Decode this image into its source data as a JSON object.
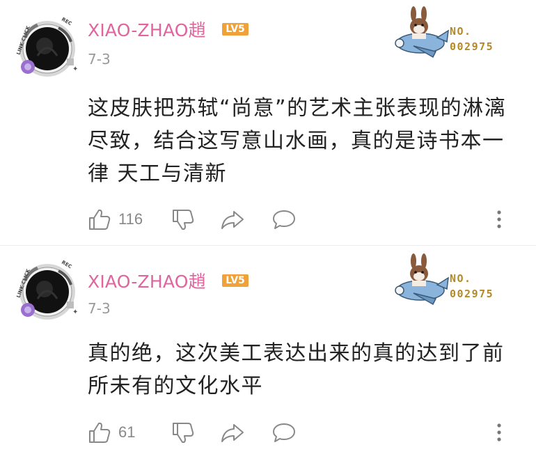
{
  "comments": [
    {
      "username": "XIAO-ZHAO趙",
      "level": "LV5",
      "date": "7-3",
      "badge": {
        "line1": "NO.",
        "line2": "002975"
      },
      "avatar": {
        "ring_text_left": "LINK-CLICK",
        "ring_text_top": "REC"
      },
      "text": "这皮肤把苏轼“尚意”的艺术主张表现的淋漓尽致，结合这写意山水画，真的是诗书本一律 天工与清新",
      "like_count": "116",
      "icons": [
        "thumbs-up-icon",
        "thumbs-down-icon",
        "share-icon",
        "comment-bubble-icon",
        "more-vertical-icon"
      ]
    },
    {
      "username": "XIAO-ZHAO趙",
      "level": "LV5",
      "date": "7-3",
      "badge": {
        "line1": "NO.",
        "line2": "002975"
      },
      "avatar": {
        "ring_text_left": "LINK-CLICK",
        "ring_text_top": "REC"
      },
      "text": "真的绝，这次美工表达出来的真的达到了前所未有的文化水平",
      "like_count": "61",
      "icons": [
        "thumbs-up-icon",
        "thumbs-down-icon",
        "share-icon",
        "comment-bubble-icon",
        "more-vertical-icon"
      ]
    }
  ],
  "colors": {
    "username": "#e0649e",
    "level_badge": "#f0a23a",
    "badge_text": "#b38a2a",
    "meta_text": "#999999",
    "icon": "#888888",
    "body_text": "#222222",
    "divider": "#ececec"
  }
}
